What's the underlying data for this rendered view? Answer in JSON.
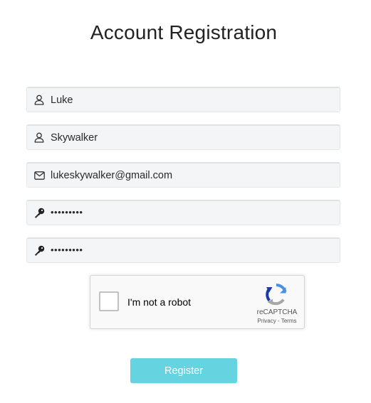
{
  "page": {
    "title": "Account Registration"
  },
  "form": {
    "fields": [
      {
        "icon": "user-icon",
        "value": "Luke",
        "type": "text"
      },
      {
        "icon": "user-icon",
        "value": "Skywalker",
        "type": "text"
      },
      {
        "icon": "envelope-icon",
        "value": "lukeskywalker@gmail.com",
        "type": "email"
      },
      {
        "icon": "key-icon",
        "value": "•••••••••",
        "type": "password"
      },
      {
        "icon": "key-icon",
        "value": "•••••••••",
        "type": "password"
      }
    ]
  },
  "captcha": {
    "checkbox_label": "I'm not a robot",
    "brand": "reCAPTCHA",
    "privacy": "Privacy",
    "separator": " - ",
    "terms": "Terms",
    "checked": false,
    "logo_icon": "recaptcha-logo-icon"
  },
  "actions": {
    "register_label": "Register",
    "register_color": "#66d3e1"
  },
  "colors": {
    "field_background": "#f4f5f6",
    "title_text": "#222222"
  }
}
